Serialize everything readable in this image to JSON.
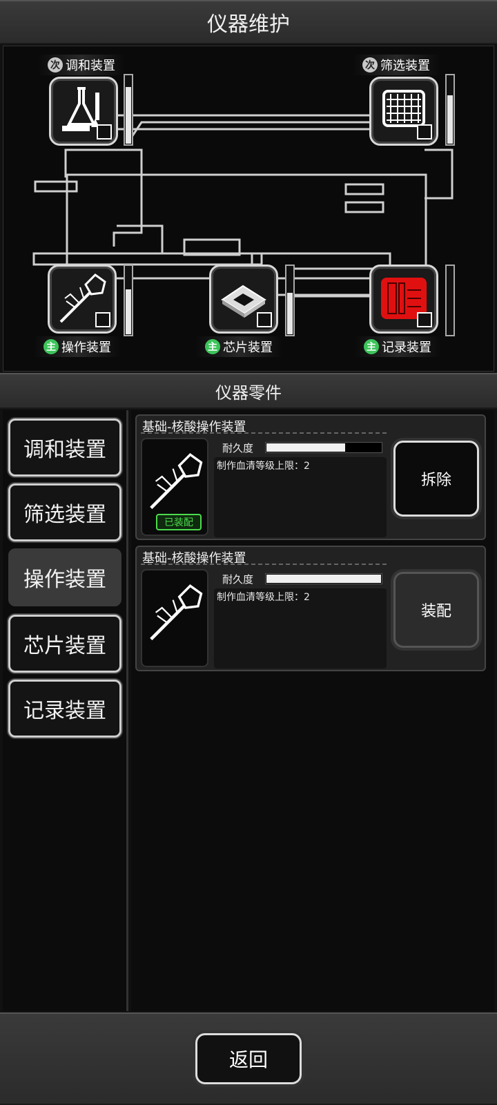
{
  "header": {
    "title": "仪器维护"
  },
  "machine": {
    "slots": [
      {
        "label": "调和装置",
        "badge": "次",
        "badge_type": "sub",
        "icon": "flask-icon",
        "gauge_level": 0.82
      },
      {
        "label": "筛选装置",
        "badge": "次",
        "badge_type": "sub",
        "icon": "grid-screen-icon",
        "gauge_level": 0.7
      },
      {
        "label": "操作装置",
        "badge": "主",
        "badge_type": "main",
        "icon": "bacteriophage-icon",
        "gauge_level": 0.65
      },
      {
        "label": "芯片装置",
        "badge": "主",
        "badge_type": "main",
        "icon": "chip-icon",
        "gauge_level": 0.6
      },
      {
        "label": "记录装置",
        "badge": "主",
        "badge_type": "main",
        "icon": "recorder-icon",
        "gauge_level": 0.0,
        "alert_color": "#e01010"
      }
    ]
  },
  "parts_header": {
    "title": "仪器零件"
  },
  "sidebar": {
    "items": [
      {
        "label": "调和装置",
        "active": false
      },
      {
        "label": "筛选装置",
        "active": false
      },
      {
        "label": "操作装置",
        "active": true
      },
      {
        "label": "芯片装置",
        "active": false
      },
      {
        "label": "记录装置",
        "active": false
      }
    ]
  },
  "parts": [
    {
      "name": "基础-核酸操作装置",
      "durability_label": "耐久度",
      "durability": 0.68,
      "description": "制作血清等级上限：2",
      "equipped_label": "已装配",
      "action": "拆除"
    },
    {
      "name": "基础-核酸操作装置",
      "durability_label": "耐久度",
      "durability": 1.0,
      "description": "制作血清等级上限：2",
      "action": "装配"
    }
  ],
  "footer": {
    "back_label": "返回"
  },
  "colors": {
    "equipped_green": "#4cdc4c",
    "main_badge": "#3cc45a",
    "alert_red": "#e01010"
  }
}
